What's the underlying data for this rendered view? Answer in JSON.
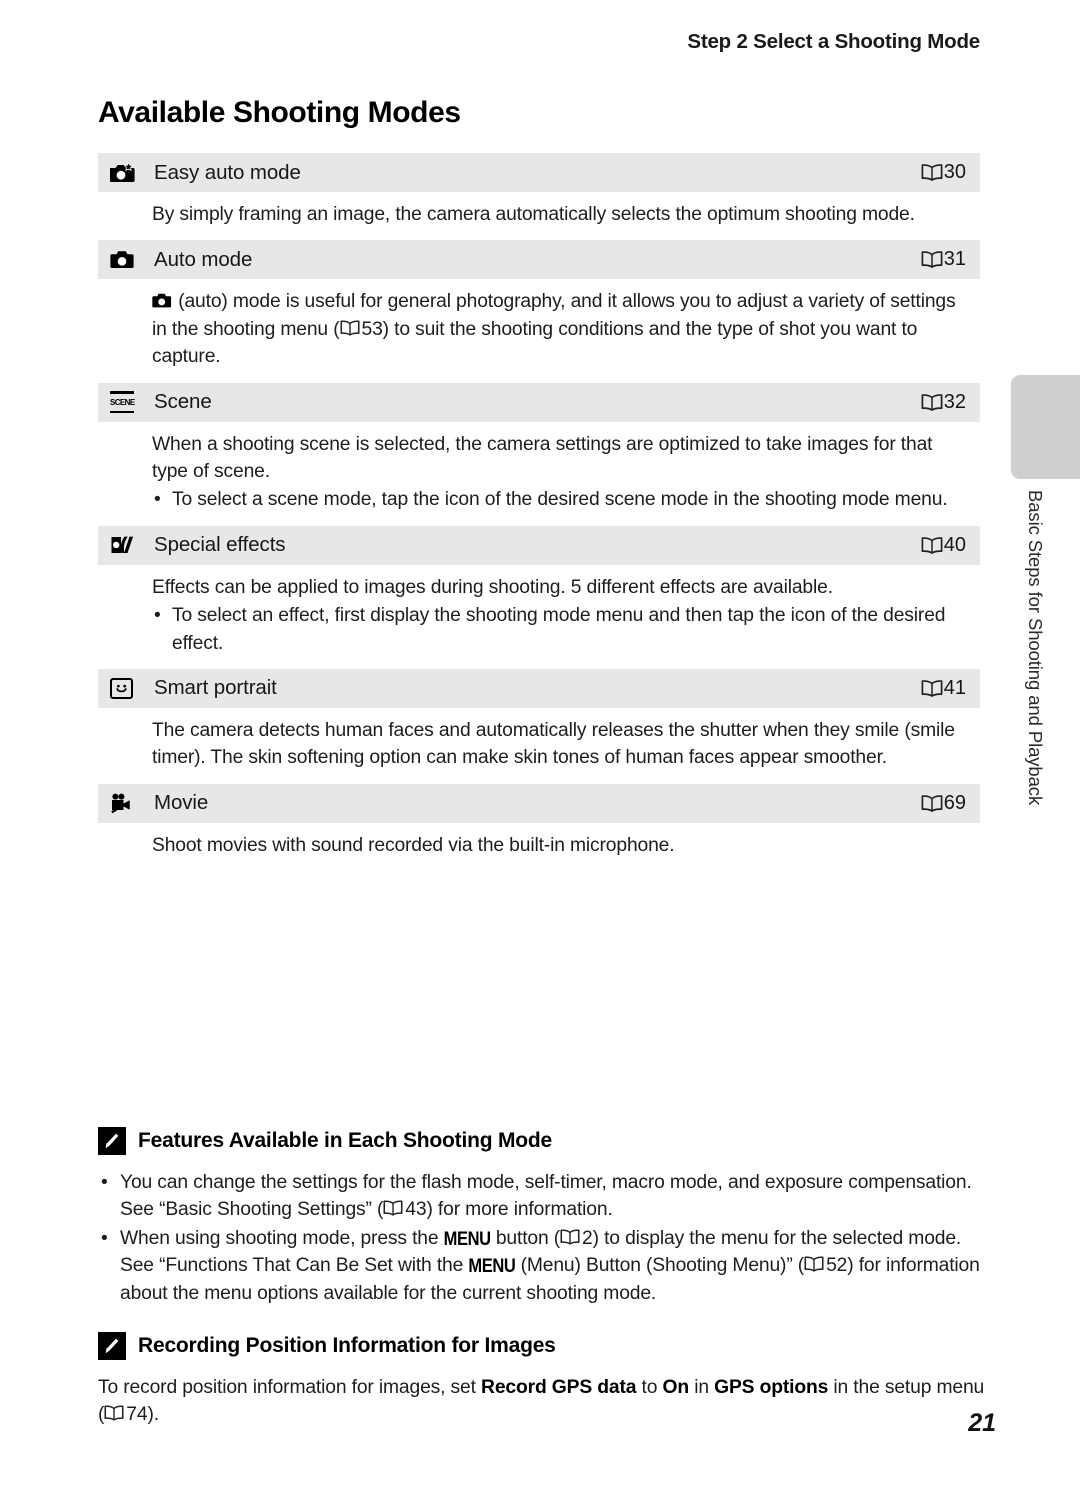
{
  "header": {
    "running_head": "Step 2 Select a Shooting Mode"
  },
  "page_title": "Available Shooting Modes",
  "modes": [
    {
      "icon": "camera-sparkle-icon",
      "label": "Easy auto mode",
      "page_ref": "30",
      "description": "By simply framing an image, the camera automatically selects the optimum shooting mode.",
      "bullets": []
    },
    {
      "icon": "camera-icon",
      "label": "Auto mode",
      "page_ref": "31",
      "description_parts": [
        " (auto) mode is useful for general photography, and it allows you to adjust a variety of settings in the shooting menu (",
        "53) to suit the shooting conditions and the type of shot you want to capture."
      ],
      "inline_ref": "53",
      "bullets": []
    },
    {
      "icon": "scene-icon",
      "label": "Scene",
      "page_ref": "32",
      "description": "When a shooting scene is selected, the camera settings are optimized to take images for that type of scene.",
      "bullets": [
        "To select a scene mode, tap the icon of the desired scene mode in the shooting mode menu."
      ]
    },
    {
      "icon": "special-effects-icon",
      "label": "Special effects",
      "page_ref": "40",
      "description": "Effects can be applied to images during shooting. 5 different effects are available.",
      "bullets": [
        "To select an effect, first display the shooting mode menu and then tap the icon of the desired effect."
      ]
    },
    {
      "icon": "smile-face-icon",
      "label": "Smart portrait",
      "page_ref": "41",
      "description": "The camera detects human faces and automatically releases the shutter when they smile (smile timer). The skin softening option can make skin tones of human faces appear smoother.",
      "bullets": []
    },
    {
      "icon": "movie-camera-icon",
      "label": "Movie",
      "page_ref": "69",
      "description": "Shoot movies with sound recorded via the built-in microphone.",
      "bullets": []
    }
  ],
  "notes": [
    {
      "title": "Features Available in Each Shooting Mode",
      "bullets": [
        {
          "parts": [
            "You can change the settings for the flash mode, self-timer, macro mode, and exposure compensation. See “Basic Shooting Settings” (",
            "43) for more information."
          ],
          "refs": [
            "43"
          ]
        },
        {
          "parts": [
            "When using shooting mode, press the ",
            "MENU",
            " button (",
            "2",
            ") to display the menu for the selected mode. See “Functions That Can Be Set with the ",
            "MENU",
            " (Menu) Button (Shooting Menu)” (",
            "52",
            ") for information about the menu options available for the current shooting mode."
          ]
        }
      ]
    },
    {
      "title": "Recording Position Information for Images",
      "body_parts": [
        "To record position information for images, set ",
        "Record GPS data",
        " to ",
        "On",
        " in ",
        "GPS options",
        " in the setup menu (",
        "74",
        ")."
      ]
    }
  ],
  "side_tab": {
    "label": "Basic Steps for Shooting and Playback"
  },
  "page_number": "21",
  "colors": {
    "row_header_bg": "#e7e7e7",
    "side_tab_bg": "#cfcfcf",
    "text": "#1d1d1d"
  }
}
